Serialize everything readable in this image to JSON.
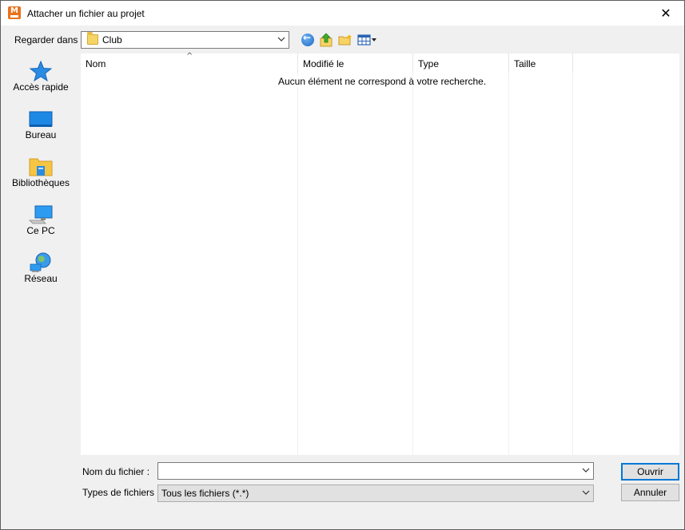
{
  "window": {
    "title": "Attacher un fichier au projet",
    "close_glyph": "✕"
  },
  "lookin": {
    "label": "Regarder dans :",
    "value": "Club"
  },
  "toolbar": {
    "back": "back-icon",
    "up": "up-folder-icon",
    "new_folder": "new-folder-icon",
    "view": "view-menu-icon"
  },
  "places": [
    {
      "label": "Accès rapide",
      "icon": "star-icon"
    },
    {
      "label": "Bureau",
      "icon": "desktop-icon"
    },
    {
      "label": "Bibliothèques",
      "icon": "libraries-icon"
    },
    {
      "label": "Ce PC",
      "icon": "computer-icon"
    },
    {
      "label": "Réseau",
      "icon": "network-icon"
    }
  ],
  "columns": [
    "Nom",
    "Modifié le",
    "Type",
    "Taille"
  ],
  "empty_message": "Aucun élément ne correspond à votre recherche.",
  "filename": {
    "label": "Nom du fichier :",
    "value": ""
  },
  "filetype": {
    "label": "Types de fichiers :",
    "value": "Tous les fichiers (*.*)"
  },
  "buttons": {
    "open": "Ouvrir",
    "cancel": "Annuler"
  },
  "colors": {
    "accent": "#0078d7",
    "folder": "#f6d465"
  }
}
